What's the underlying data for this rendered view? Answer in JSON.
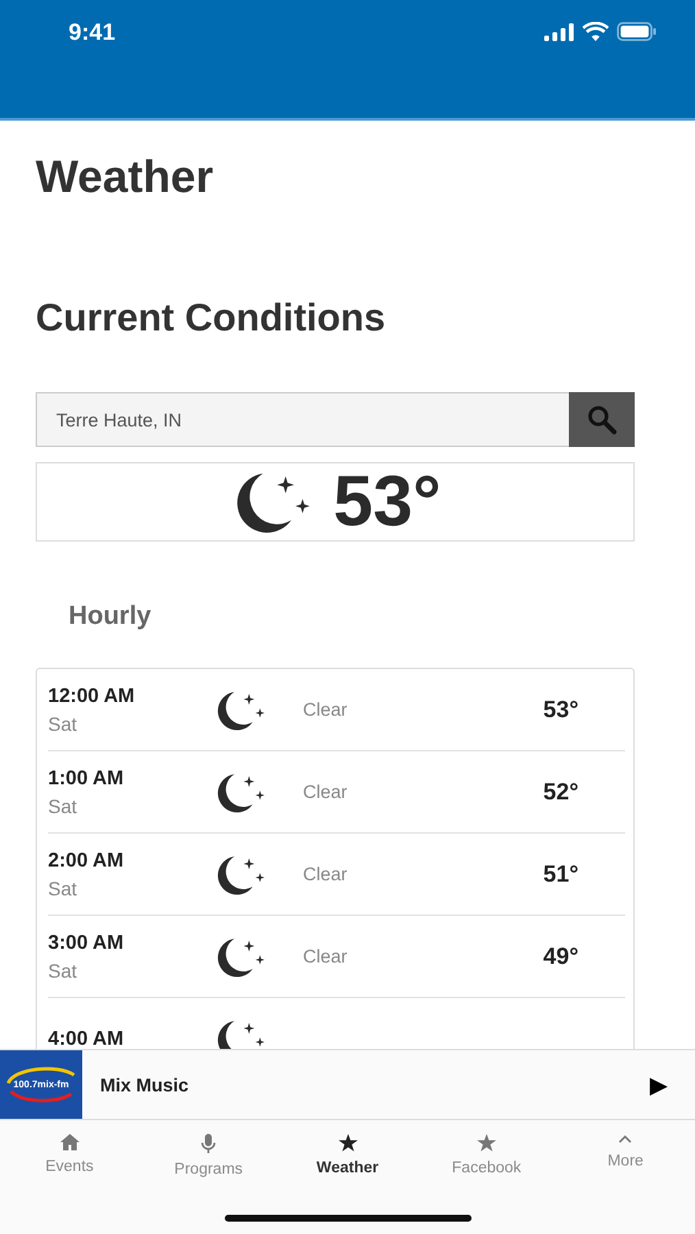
{
  "status_bar": {
    "time": "9:41"
  },
  "page_title": "Weather",
  "section_title": "Current Conditions",
  "search": {
    "value": "Terre Haute, IN"
  },
  "current": {
    "temperature": "53°"
  },
  "hourly_title": "Hourly",
  "hourly": [
    {
      "time": "12:00 AM",
      "day": "Sat",
      "condition": "Clear",
      "temperature": "53°"
    },
    {
      "time": "1:00 AM",
      "day": "Sat",
      "condition": "Clear",
      "temperature": "52°"
    },
    {
      "time": "2:00 AM",
      "day": "Sat",
      "condition": "Clear",
      "temperature": "51°"
    },
    {
      "time": "3:00 AM",
      "day": "Sat",
      "condition": "Clear",
      "temperature": "49°"
    },
    {
      "time": "4:00 AM"
    }
  ],
  "player": {
    "logo": "100.7mix-fm",
    "title": "Mix Music",
    "play": "▶"
  },
  "tabs": [
    {
      "kind": "home",
      "label": "Events",
      "selected": false
    },
    {
      "kind": "mic",
      "label": "Programs",
      "selected": false
    },
    {
      "kind": "star",
      "label": "Weather",
      "selected": true
    },
    {
      "kind": "star",
      "label": "Facebook",
      "selected": false
    },
    {
      "kind": "caret",
      "label": "More",
      "selected": false
    }
  ]
}
